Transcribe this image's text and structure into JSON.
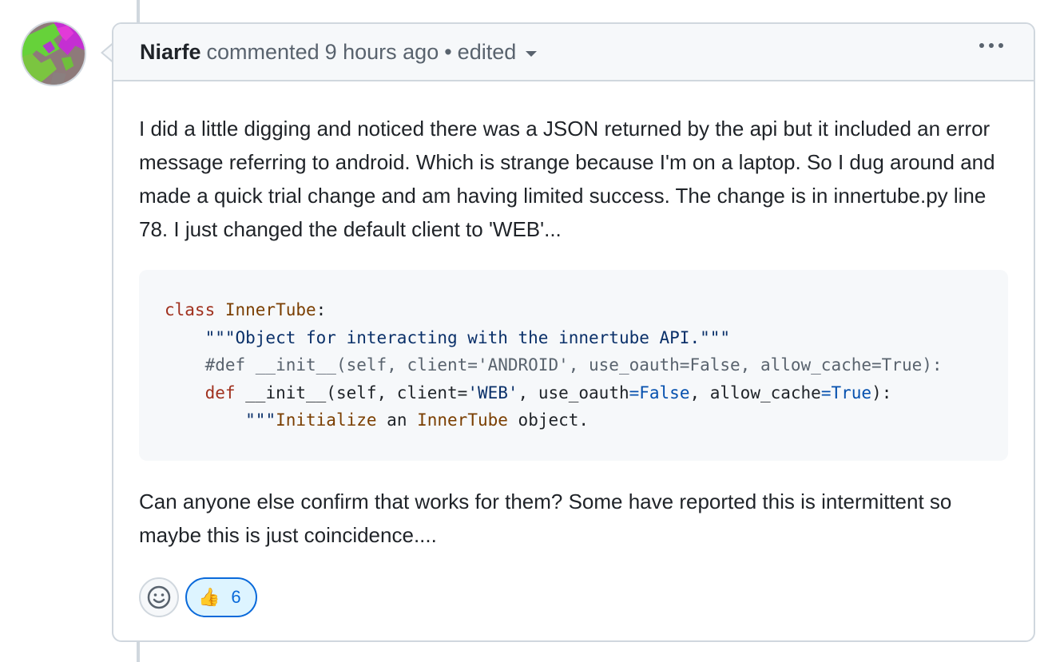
{
  "comment": {
    "author": "Niarfe",
    "action": "commented",
    "time": "9 hours ago",
    "separator": "•",
    "edited_label": "edited",
    "menu_icon": "kebab-horizontal-icon",
    "avatar_icon": "avatar-identicon",
    "paragraph_1": "I did a little digging and noticed there was a JSON returned by the api but it included an error message referring to android. Which is strange because I'm on a laptop. So I dug around and made a quick trial change and am having limited success. The change is in innertube.py line 78. I just changed the default client to 'WEB'...",
    "paragraph_2": "Can anyone else confirm that works for them? Some have reported this is intermittent so maybe this is just coincidence....",
    "code_lines": [
      "class InnerTube:",
      "    \"\"\"Object for interacting with the innertube API.\"\"\"",
      "    #def __init__(self, client='ANDROID', use_oauth=False, allow_cache=True):",
      "    def __init__(self, client='WEB', use_oauth=False, allow_cache=True):",
      "        \"\"\"Initialize an InnerTube object."
    ]
  },
  "reactions": {
    "add_icon": "smiley-icon",
    "items": [
      {
        "emoji": "👍",
        "icon": "thumbs-up-icon",
        "count": "6"
      }
    ]
  },
  "colors": {
    "border": "#d0d7de",
    "header_bg": "#f6f8fa",
    "accent": "#0969da",
    "reaction_bg": "#ddf4ff"
  }
}
